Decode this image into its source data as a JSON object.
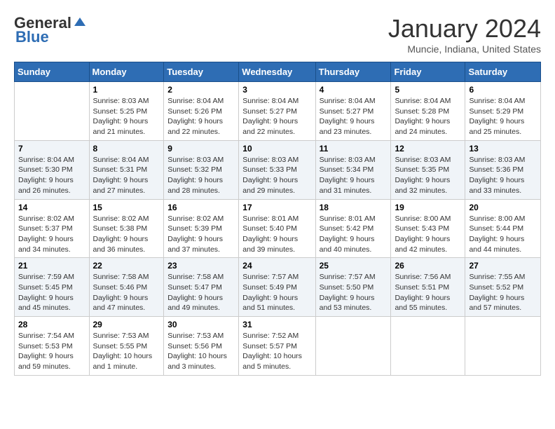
{
  "header": {
    "logo_general": "General",
    "logo_blue": "Blue",
    "month_title": "January 2024",
    "location": "Muncie, Indiana, United States"
  },
  "weekdays": [
    "Sunday",
    "Monday",
    "Tuesday",
    "Wednesday",
    "Thursday",
    "Friday",
    "Saturday"
  ],
  "weeks": [
    [
      {
        "day": "",
        "sunrise": "",
        "sunset": "",
        "daylight": ""
      },
      {
        "day": "1",
        "sunrise": "Sunrise: 8:03 AM",
        "sunset": "Sunset: 5:25 PM",
        "daylight": "Daylight: 9 hours and 21 minutes."
      },
      {
        "day": "2",
        "sunrise": "Sunrise: 8:04 AM",
        "sunset": "Sunset: 5:26 PM",
        "daylight": "Daylight: 9 hours and 22 minutes."
      },
      {
        "day": "3",
        "sunrise": "Sunrise: 8:04 AM",
        "sunset": "Sunset: 5:27 PM",
        "daylight": "Daylight: 9 hours and 22 minutes."
      },
      {
        "day": "4",
        "sunrise": "Sunrise: 8:04 AM",
        "sunset": "Sunset: 5:27 PM",
        "daylight": "Daylight: 9 hours and 23 minutes."
      },
      {
        "day": "5",
        "sunrise": "Sunrise: 8:04 AM",
        "sunset": "Sunset: 5:28 PM",
        "daylight": "Daylight: 9 hours and 24 minutes."
      },
      {
        "day": "6",
        "sunrise": "Sunrise: 8:04 AM",
        "sunset": "Sunset: 5:29 PM",
        "daylight": "Daylight: 9 hours and 25 minutes."
      }
    ],
    [
      {
        "day": "7",
        "sunrise": "Sunrise: 8:04 AM",
        "sunset": "Sunset: 5:30 PM",
        "daylight": "Daylight: 9 hours and 26 minutes."
      },
      {
        "day": "8",
        "sunrise": "Sunrise: 8:04 AM",
        "sunset": "Sunset: 5:31 PM",
        "daylight": "Daylight: 9 hours and 27 minutes."
      },
      {
        "day": "9",
        "sunrise": "Sunrise: 8:03 AM",
        "sunset": "Sunset: 5:32 PM",
        "daylight": "Daylight: 9 hours and 28 minutes."
      },
      {
        "day": "10",
        "sunrise": "Sunrise: 8:03 AM",
        "sunset": "Sunset: 5:33 PM",
        "daylight": "Daylight: 9 hours and 29 minutes."
      },
      {
        "day": "11",
        "sunrise": "Sunrise: 8:03 AM",
        "sunset": "Sunset: 5:34 PM",
        "daylight": "Daylight: 9 hours and 31 minutes."
      },
      {
        "day": "12",
        "sunrise": "Sunrise: 8:03 AM",
        "sunset": "Sunset: 5:35 PM",
        "daylight": "Daylight: 9 hours and 32 minutes."
      },
      {
        "day": "13",
        "sunrise": "Sunrise: 8:03 AM",
        "sunset": "Sunset: 5:36 PM",
        "daylight": "Daylight: 9 hours and 33 minutes."
      }
    ],
    [
      {
        "day": "14",
        "sunrise": "Sunrise: 8:02 AM",
        "sunset": "Sunset: 5:37 PM",
        "daylight": "Daylight: 9 hours and 34 minutes."
      },
      {
        "day": "15",
        "sunrise": "Sunrise: 8:02 AM",
        "sunset": "Sunset: 5:38 PM",
        "daylight": "Daylight: 9 hours and 36 minutes."
      },
      {
        "day": "16",
        "sunrise": "Sunrise: 8:02 AM",
        "sunset": "Sunset: 5:39 PM",
        "daylight": "Daylight: 9 hours and 37 minutes."
      },
      {
        "day": "17",
        "sunrise": "Sunrise: 8:01 AM",
        "sunset": "Sunset: 5:40 PM",
        "daylight": "Daylight: 9 hours and 39 minutes."
      },
      {
        "day": "18",
        "sunrise": "Sunrise: 8:01 AM",
        "sunset": "Sunset: 5:42 PM",
        "daylight": "Daylight: 9 hours and 40 minutes."
      },
      {
        "day": "19",
        "sunrise": "Sunrise: 8:00 AM",
        "sunset": "Sunset: 5:43 PM",
        "daylight": "Daylight: 9 hours and 42 minutes."
      },
      {
        "day": "20",
        "sunrise": "Sunrise: 8:00 AM",
        "sunset": "Sunset: 5:44 PM",
        "daylight": "Daylight: 9 hours and 44 minutes."
      }
    ],
    [
      {
        "day": "21",
        "sunrise": "Sunrise: 7:59 AM",
        "sunset": "Sunset: 5:45 PM",
        "daylight": "Daylight: 9 hours and 45 minutes."
      },
      {
        "day": "22",
        "sunrise": "Sunrise: 7:58 AM",
        "sunset": "Sunset: 5:46 PM",
        "daylight": "Daylight: 9 hours and 47 minutes."
      },
      {
        "day": "23",
        "sunrise": "Sunrise: 7:58 AM",
        "sunset": "Sunset: 5:47 PM",
        "daylight": "Daylight: 9 hours and 49 minutes."
      },
      {
        "day": "24",
        "sunrise": "Sunrise: 7:57 AM",
        "sunset": "Sunset: 5:49 PM",
        "daylight": "Daylight: 9 hours and 51 minutes."
      },
      {
        "day": "25",
        "sunrise": "Sunrise: 7:57 AM",
        "sunset": "Sunset: 5:50 PM",
        "daylight": "Daylight: 9 hours and 53 minutes."
      },
      {
        "day": "26",
        "sunrise": "Sunrise: 7:56 AM",
        "sunset": "Sunset: 5:51 PM",
        "daylight": "Daylight: 9 hours and 55 minutes."
      },
      {
        "day": "27",
        "sunrise": "Sunrise: 7:55 AM",
        "sunset": "Sunset: 5:52 PM",
        "daylight": "Daylight: 9 hours and 57 minutes."
      }
    ],
    [
      {
        "day": "28",
        "sunrise": "Sunrise: 7:54 AM",
        "sunset": "Sunset: 5:53 PM",
        "daylight": "Daylight: 9 hours and 59 minutes."
      },
      {
        "day": "29",
        "sunrise": "Sunrise: 7:53 AM",
        "sunset": "Sunset: 5:55 PM",
        "daylight": "Daylight: 10 hours and 1 minute."
      },
      {
        "day": "30",
        "sunrise": "Sunrise: 7:53 AM",
        "sunset": "Sunset: 5:56 PM",
        "daylight": "Daylight: 10 hours and 3 minutes."
      },
      {
        "day": "31",
        "sunrise": "Sunrise: 7:52 AM",
        "sunset": "Sunset: 5:57 PM",
        "daylight": "Daylight: 10 hours and 5 minutes."
      },
      {
        "day": "",
        "sunrise": "",
        "sunset": "",
        "daylight": ""
      },
      {
        "day": "",
        "sunrise": "",
        "sunset": "",
        "daylight": ""
      },
      {
        "day": "",
        "sunrise": "",
        "sunset": "",
        "daylight": ""
      }
    ]
  ]
}
